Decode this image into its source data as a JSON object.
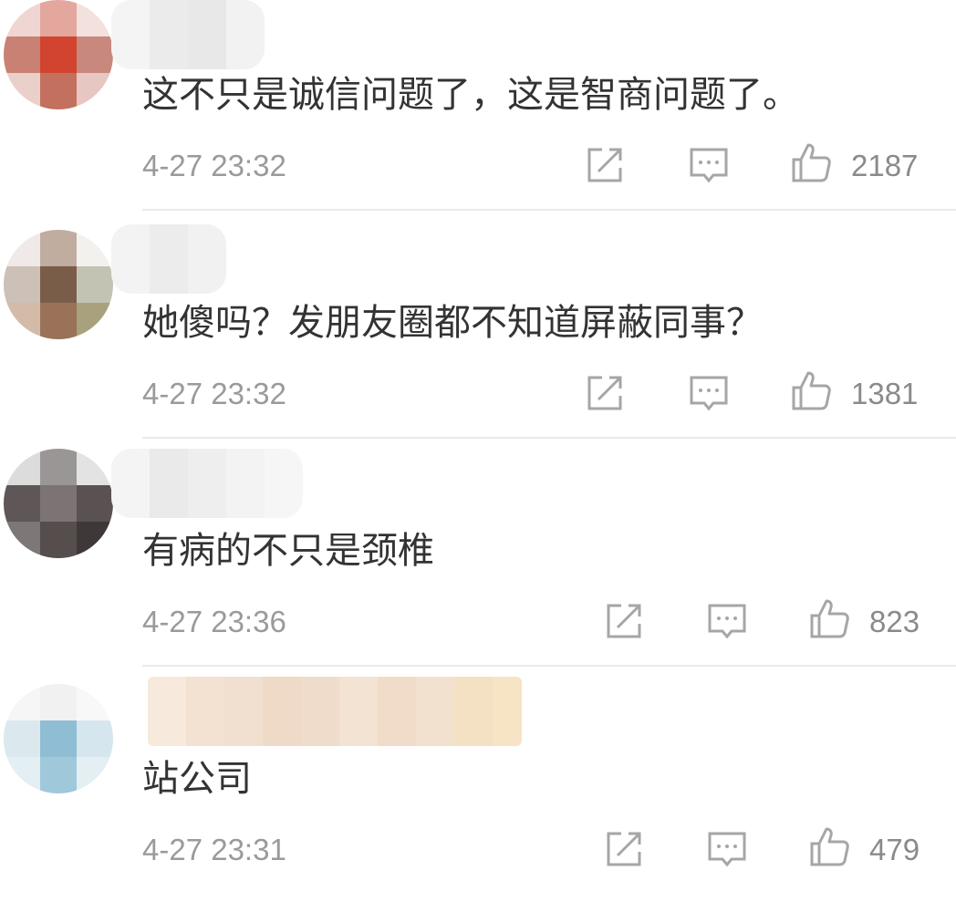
{
  "comments": [
    {
      "text": "这不只是诚信问题了，这是智商问题了。",
      "time": "4-27 23:32",
      "likes": "2187",
      "icons": [
        "share-icon",
        "comment-icon",
        "thumbs-up-icon"
      ]
    },
    {
      "text": "她傻吗？发朋友圈都不知道屏蔽同事？",
      "time": "4-27 23:32",
      "likes": "1381",
      "icons": [
        "share-icon",
        "comment-icon",
        "thumbs-up-icon"
      ]
    },
    {
      "text": "有病的不只是颈椎",
      "time": "4-27 23:36",
      "likes": "823",
      "icons": [
        "share-icon",
        "comment-icon",
        "thumbs-up-icon"
      ]
    },
    {
      "text": "站公司",
      "time": "4-27 23:31",
      "likes": "479",
      "icons": [
        "share-icon",
        "comment-icon",
        "thumbs-up-icon"
      ]
    }
  ],
  "colors": {
    "text": "#333333",
    "meta": "#9a9a9a",
    "icon": "#a6a6a6",
    "divider": "#e9e9e9"
  }
}
